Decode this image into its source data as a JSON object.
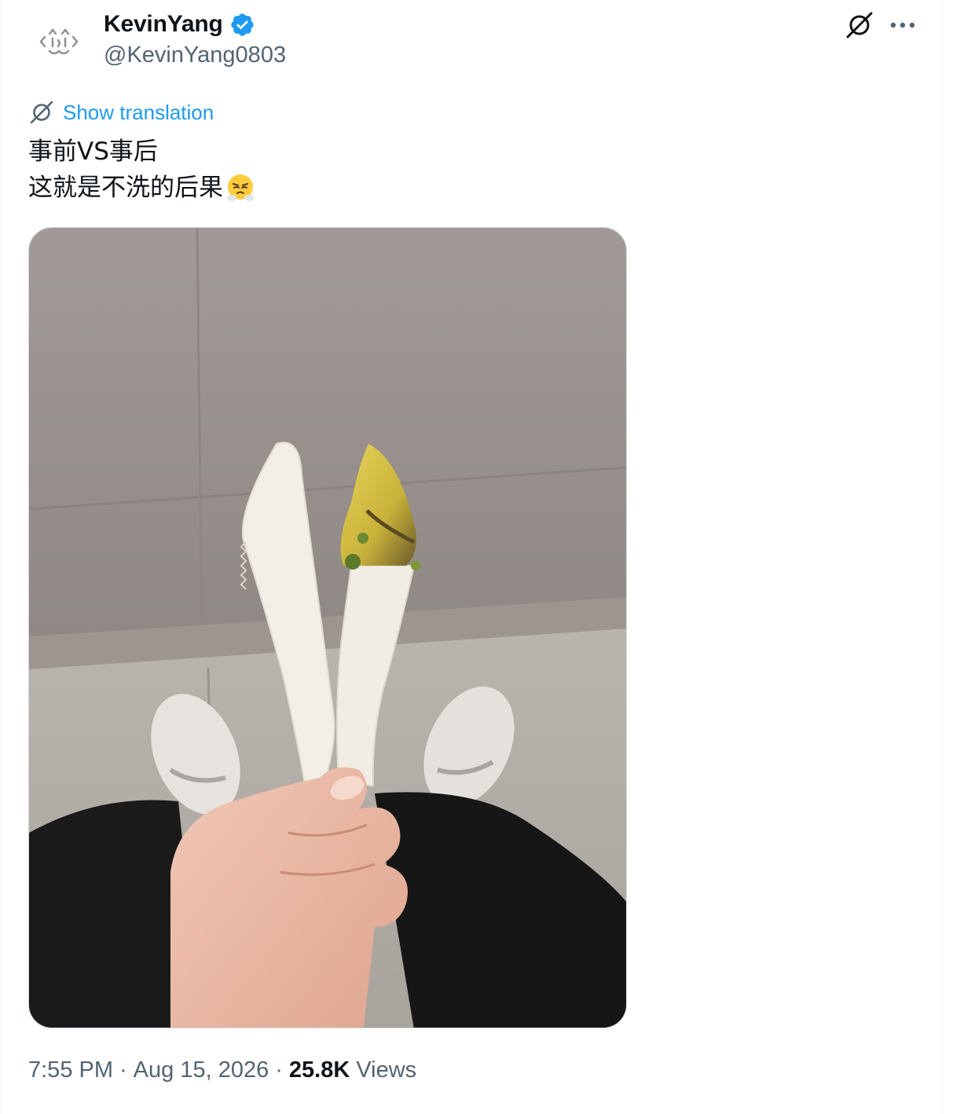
{
  "author": {
    "display_name": "KevinYang",
    "handle": "@KevinYang0803",
    "verified": true,
    "verified_color": "#1d9bf0"
  },
  "actions": {
    "grok_icon": "grok-icon",
    "more_icon": "more-dots-icon"
  },
  "translation": {
    "label": "Show translation",
    "color": "#1d9bf0"
  },
  "tweet": {
    "line1": "事前VS事后",
    "line2": "这就是不洗的后果",
    "emoji": "face-with-steam-from-nose"
  },
  "media": {
    "icon": "photo-two-plastic-knives"
  },
  "meta": {
    "time": "7:55 PM",
    "separator": "·",
    "date": "Aug 15, 2026",
    "views_count": "25.8K",
    "views_label": "Views"
  }
}
